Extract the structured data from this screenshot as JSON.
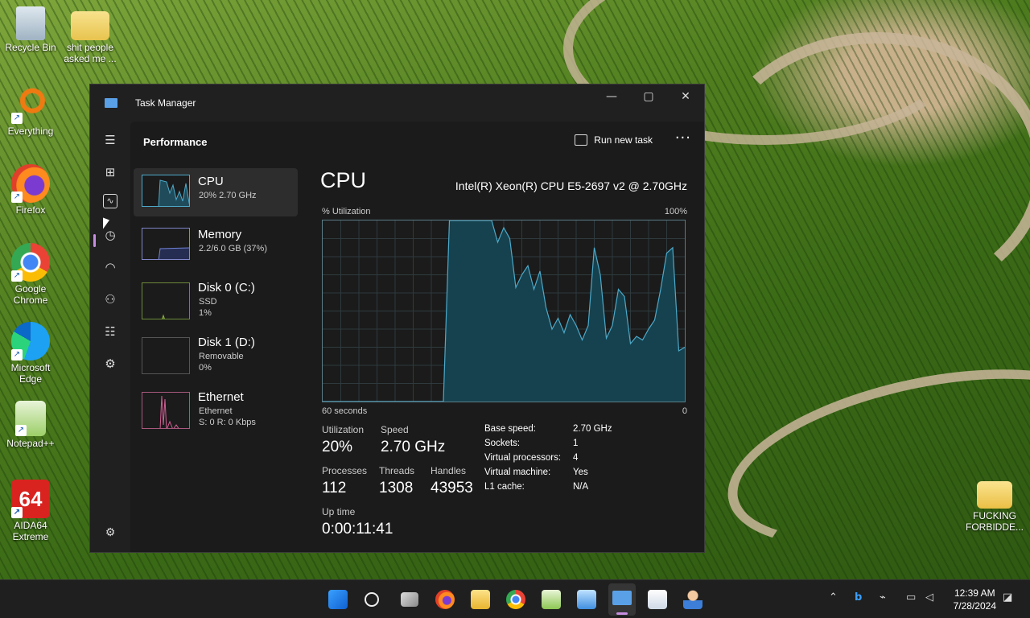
{
  "desktop": {
    "icons": [
      {
        "label": "Recycle Bin",
        "icon": "recycle-bin-icon"
      },
      {
        "label": "shit people asked me ...",
        "icon": "folder-icon"
      },
      {
        "label": "Everything",
        "icon": "everything-search-icon"
      },
      {
        "label": "Firefox",
        "icon": "firefox-icon"
      },
      {
        "label": "Google Chrome",
        "icon": "chrome-icon"
      },
      {
        "label": "Microsoft Edge",
        "icon": "edge-icon"
      },
      {
        "label": "Notepad++",
        "icon": "notepadpp-icon"
      },
      {
        "label": "AIDA64 Extreme",
        "icon": "aida64-icon"
      },
      {
        "label": "FUCKING FORBIDDE...",
        "icon": "folder-icon"
      }
    ]
  },
  "window": {
    "title": "Task Manager",
    "section_title": "Performance",
    "run_new_task": "Run new task",
    "more": "···",
    "controls": {
      "minimize": "—",
      "maximize": "▢",
      "close": "✕"
    }
  },
  "resources": [
    {
      "name": "CPU",
      "sub1": "20%  2.70 GHz",
      "sub2": "",
      "sub3": ""
    },
    {
      "name": "Memory",
      "sub1": "2.2/6.0 GB (37%)",
      "sub2": "",
      "sub3": ""
    },
    {
      "name": "Disk 0 (C:)",
      "sub1": "SSD",
      "sub2": "1%",
      "sub3": ""
    },
    {
      "name": "Disk 1 (D:)",
      "sub1": "Removable",
      "sub2": "0%",
      "sub3": ""
    },
    {
      "name": "Ethernet",
      "sub1": "Ethernet",
      "sub2": "S: 0 R: 0 Kbps",
      "sub3": ""
    }
  ],
  "detail": {
    "title": "CPU",
    "model": "Intel(R) Xeon(R) CPU E5-2697 v2 @ 2.70GHz",
    "y_label": "% Utilization",
    "y_max": "100%",
    "x_left": "60 seconds",
    "x_right": "0",
    "utilization_label": "Utilization",
    "utilization": "20%",
    "speed_label": "Speed",
    "speed": "2.70 GHz",
    "processes_label": "Processes",
    "processes": "112",
    "threads_label": "Threads",
    "threads": "1308",
    "handles_label": "Handles",
    "handles": "43953",
    "uptime_label": "Up time",
    "uptime": "0:00:11:41",
    "specs": [
      {
        "k": "Base speed:",
        "v": "2.70 GHz"
      },
      {
        "k": "Sockets:",
        "v": "1"
      },
      {
        "k": "Virtual processors:",
        "v": "4"
      },
      {
        "k": "Virtual machine:",
        "v": "Yes"
      },
      {
        "k": "L1 cache:",
        "v": "N/A"
      }
    ]
  },
  "chart_data": {
    "type": "area",
    "xlabel": "60 seconds",
    "ylabel": "% Utilization",
    "ylim": [
      0,
      100
    ],
    "x": [
      60,
      59,
      58,
      57,
      56,
      55,
      54,
      53,
      52,
      51,
      50,
      49,
      48,
      47,
      46,
      45,
      44,
      43,
      42,
      41,
      40,
      39,
      38,
      37,
      36,
      35,
      34,
      33,
      32,
      31,
      30,
      29,
      28,
      27,
      26,
      25,
      24,
      23,
      22,
      21,
      20,
      19,
      18,
      17,
      16,
      15,
      14,
      13,
      12,
      11,
      10,
      9,
      8,
      7,
      6,
      5,
      4,
      3,
      2,
      1,
      0
    ],
    "values": [
      0,
      0,
      0,
      0,
      0,
      0,
      0,
      0,
      0,
      0,
      0,
      0,
      0,
      0,
      0,
      0,
      0,
      0,
      0,
      0,
      0,
      100,
      100,
      100,
      100,
      100,
      100,
      100,
      100,
      88,
      96,
      90,
      63,
      70,
      75,
      62,
      72,
      52,
      40,
      46,
      38,
      48,
      42,
      34,
      42,
      85,
      70,
      35,
      42,
      62,
      58,
      32,
      36,
      34,
      40,
      45,
      62,
      82,
      85,
      28,
      30
    ],
    "color": "#4ca9c9"
  },
  "taskbar": {
    "apps": [
      "start-icon",
      "search-icon",
      "task-view-icon",
      "firefox-icon",
      "file-explorer-icon",
      "chrome-icon",
      "notepadpp-icon",
      "notepad-icon",
      "task-manager-icon",
      "snipping-icon",
      "user-app-icon"
    ],
    "time": "12:39 AM",
    "date": "7/28/2024"
  }
}
